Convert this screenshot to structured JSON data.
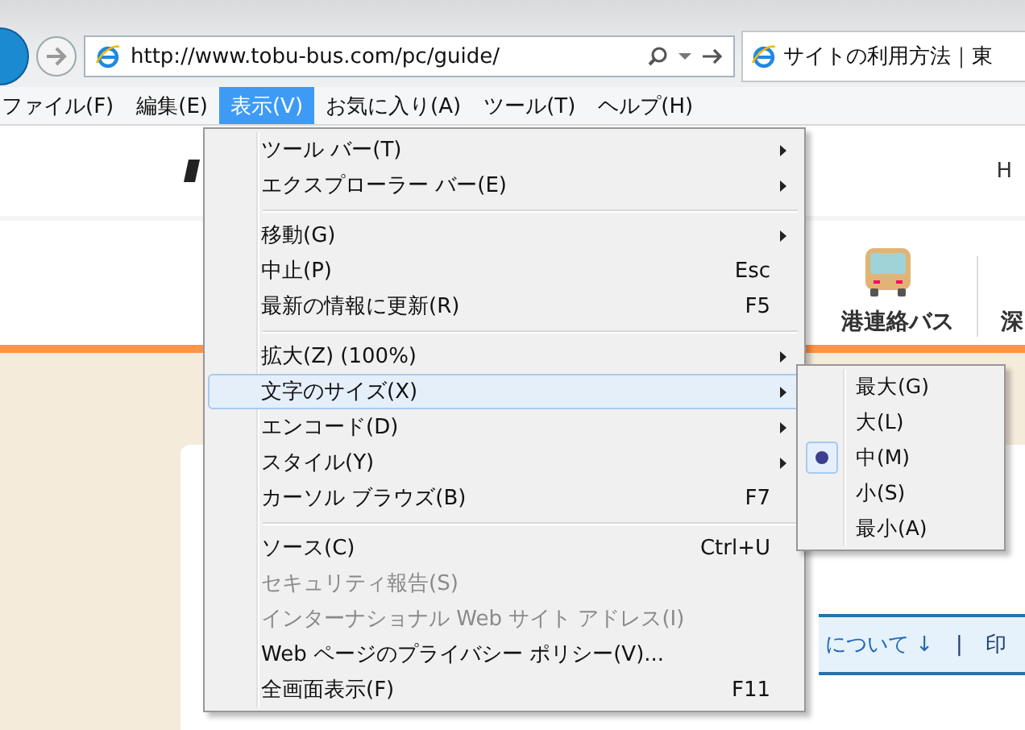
{
  "address_bar": {
    "url": "http://www.tobu-bus.com/pc/guide/"
  },
  "tab": {
    "title": "サイトの利用方法｜東"
  },
  "menu_bar": [
    {
      "label": "ファイル(F)",
      "selected": false
    },
    {
      "label": "編集(E)",
      "selected": false
    },
    {
      "label": "表示(V)",
      "selected": true
    },
    {
      "label": "お気に入り(A)",
      "selected": false
    },
    {
      "label": "ツール(T)",
      "selected": false
    },
    {
      "label": "ヘルプ(H)",
      "selected": false
    }
  ],
  "page": {
    "header_link": "H",
    "nav_items": [
      "港連絡バス",
      "深"
    ],
    "notice_links": [
      "について ↓",
      "|",
      "印"
    ]
  },
  "view_menu": [
    {
      "kind": "item",
      "label": "ツール バー(T)",
      "submenu": true,
      "disabled": false,
      "selected": false
    },
    {
      "kind": "item",
      "label": "エクスプローラー バー(E)",
      "submenu": true,
      "disabled": false,
      "selected": false
    },
    {
      "kind": "separator"
    },
    {
      "kind": "item",
      "label": "移動(G)",
      "submenu": true,
      "disabled": false,
      "selected": false
    },
    {
      "kind": "item",
      "label": "中止(P)",
      "shortcut": "Esc",
      "submenu": false,
      "disabled": false,
      "selected": false
    },
    {
      "kind": "item",
      "label": "最新の情報に更新(R)",
      "shortcut": "F5",
      "submenu": false,
      "disabled": false,
      "selected": false
    },
    {
      "kind": "separator"
    },
    {
      "kind": "item",
      "label": "拡大(Z) (100%)",
      "submenu": true,
      "disabled": false,
      "selected": false
    },
    {
      "kind": "item",
      "label": "文字のサイズ(X)",
      "submenu": true,
      "disabled": false,
      "selected": true
    },
    {
      "kind": "item",
      "label": "エンコード(D)",
      "submenu": true,
      "disabled": false,
      "selected": false
    },
    {
      "kind": "item",
      "label": "スタイル(Y)",
      "submenu": true,
      "disabled": false,
      "selected": false
    },
    {
      "kind": "item",
      "label": "カーソル ブラウズ(B)",
      "shortcut": "F7",
      "submenu": false,
      "disabled": false,
      "selected": false
    },
    {
      "kind": "separator"
    },
    {
      "kind": "item",
      "label": "ソース(C)",
      "shortcut": "Ctrl+U",
      "submenu": false,
      "disabled": false,
      "selected": false
    },
    {
      "kind": "item",
      "label": "セキュリティ報告(S)",
      "submenu": false,
      "disabled": true,
      "selected": false
    },
    {
      "kind": "item",
      "label": "インターナショナル Web サイト アドレス(I)",
      "submenu": false,
      "disabled": true,
      "selected": false
    },
    {
      "kind": "item",
      "label": "Web ページのプライバシー ポリシー(V)...",
      "submenu": false,
      "disabled": false,
      "selected": false
    },
    {
      "kind": "item",
      "label": "全画面表示(F)",
      "shortcut": "F11",
      "submenu": false,
      "disabled": false,
      "selected": false
    }
  ],
  "text_size_menu": [
    {
      "label": "最大(G)",
      "checked": false
    },
    {
      "label": "大(L)",
      "checked": false
    },
    {
      "label": "中(M)",
      "checked": true
    },
    {
      "label": "小(S)",
      "checked": false
    },
    {
      "label": "最小(A)",
      "checked": false
    }
  ]
}
